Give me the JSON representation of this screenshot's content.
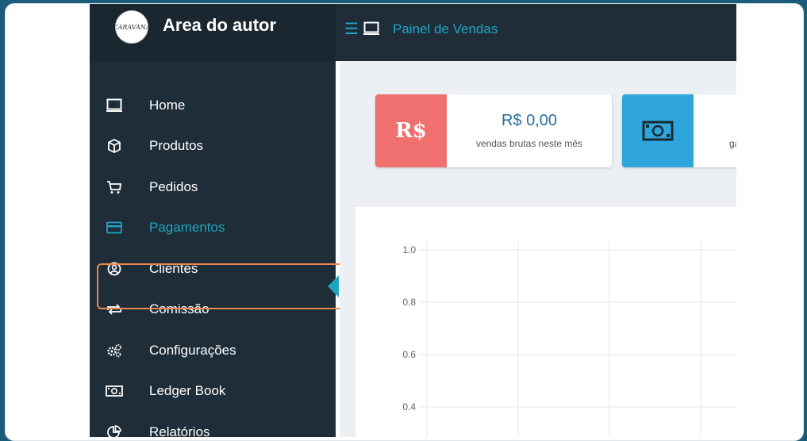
{
  "app": {
    "logo_text": "CARAVANA",
    "brand_title": "Area do autor",
    "page_title": "Painel de Vendas"
  },
  "sidebar": {
    "items": [
      {
        "label": "Home",
        "icon": "monitor-icon"
      },
      {
        "label": "Produtos",
        "icon": "box-icon"
      },
      {
        "label": "Pedidos",
        "icon": "cart-icon"
      },
      {
        "label": "Pagamentos",
        "icon": "credit-card-icon"
      },
      {
        "label": "Clientes",
        "icon": "user-circle-icon"
      },
      {
        "label": "Comissão",
        "icon": "exchange-icon"
      },
      {
        "label": "Configurações",
        "icon": "cogs-icon"
      },
      {
        "label": "Ledger Book",
        "icon": "money-icon"
      },
      {
        "label": "Relatórios",
        "icon": "pie-chart-icon"
      }
    ],
    "active_index": 0,
    "highlighted_index": 3
  },
  "cards": [
    {
      "icon_text": "R$",
      "value": "R$ 0,00",
      "label": "vendas brutas neste mês"
    },
    {
      "icon": "money-icon",
      "value": "",
      "label": "ga"
    }
  ],
  "chart_data": {
    "type": "line",
    "y_ticks": [
      "1.0",
      "0.8",
      "0.6",
      "0.4"
    ],
    "ylim": [
      0.4,
      1.0
    ],
    "grid": true,
    "series": []
  },
  "colors": {
    "accent": "#21a4c2",
    "sidebar_bg": "#1f2d38",
    "card_red": "#f06f6f",
    "card_blue": "#2ea5db",
    "highlight_border": "#e8884a"
  }
}
